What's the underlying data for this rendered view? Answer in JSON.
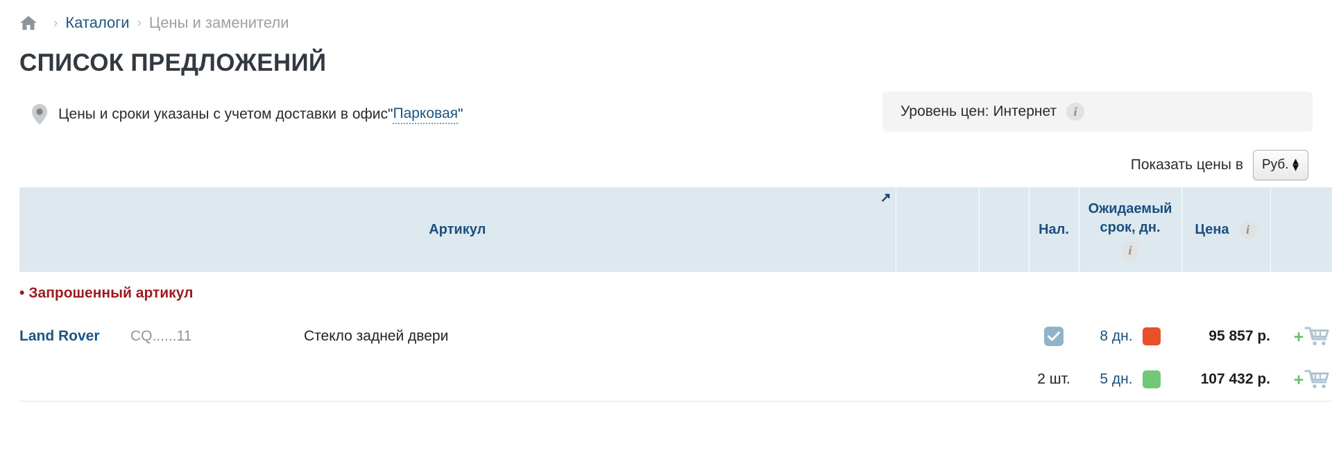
{
  "breadcrumb": {
    "home_icon": "home-icon",
    "separator": "›",
    "items": [
      {
        "label": "Каталоги",
        "type": "link"
      },
      {
        "label": "Цены и заменители",
        "type": "current"
      }
    ]
  },
  "page_title": "СПИСОК ПРЕДЛОЖЕНИЙ",
  "delivery_note": {
    "pin_icon": "map-pin-icon",
    "text_before": "Цены и сроки указаны с учетом доставки в офис ",
    "quote_open": "\"",
    "office": "Парковая",
    "quote_close": "\""
  },
  "price_level": {
    "label": "Уровень цен: Интернет",
    "info_icon": "i"
  },
  "currency": {
    "label": "Показать цены в",
    "selected": "Руб.",
    "options": [
      "Руб."
    ],
    "arrow_up": "▲",
    "arrow_down": "▼"
  },
  "table": {
    "sort_arrow": "↗",
    "headers": {
      "article": "Артикул",
      "stock": "Нал.",
      "eta_line1": "Ожидаемый",
      "eta_line2": "срок, дн.",
      "eta_info": "i",
      "price": "Цена",
      "price_info": "i"
    },
    "groups": [
      {
        "bullet": "•",
        "label": "Запрошенный артикул",
        "rows": [
          {
            "brand": "Land Rover",
            "code": "CQ......11",
            "name": "Стекло задней двери",
            "qty": "",
            "checkbox": true,
            "eta": "8 дн.",
            "avail_color": "#e8502a",
            "price": "95 857 р.",
            "cart_plus": "+",
            "cart_icon": "cart-icon"
          },
          {
            "brand": "",
            "code": "",
            "name": "",
            "qty": "2 шт.",
            "checkbox": false,
            "eta": "5 дн.",
            "avail_color": "#72c878",
            "price": "107 432 р.",
            "cart_plus": "+",
            "cart_icon": "cart-icon"
          }
        ]
      }
    ]
  },
  "colors": {
    "header_bg": "#dde8ef",
    "header_text": "#1b4f7e",
    "link": "#1b5584",
    "group_text": "#9e1b20",
    "group_bg": "#f3f3f3",
    "checkbox": "#8fb4c9",
    "cart": "#aec4d3",
    "cart_plus": "#6dc06d"
  }
}
